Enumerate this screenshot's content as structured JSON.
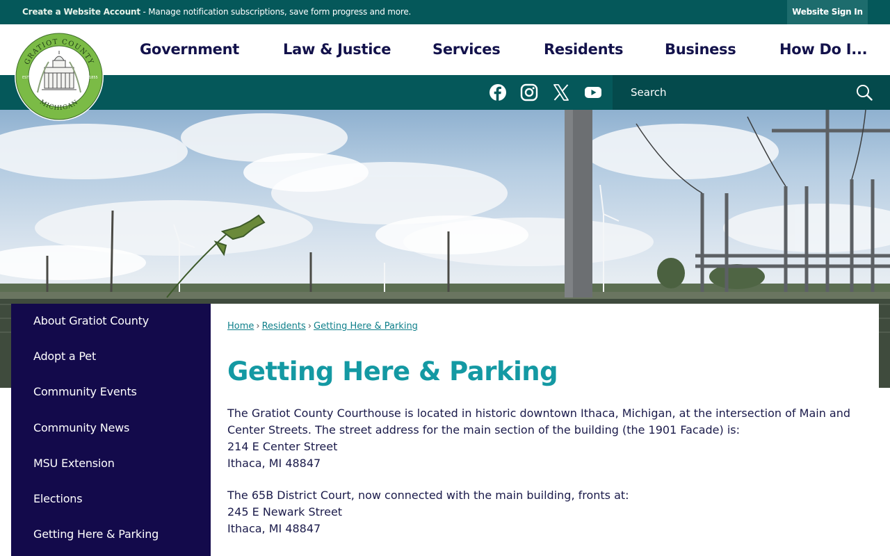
{
  "topbar": {
    "create_account": "Create a Website Account",
    "message": " - Manage notification subscriptions, save form progress and more.",
    "signin_label": "Website Sign In"
  },
  "logo": {
    "text_top": "GRATIOT COUNTY",
    "text_bottom": "MICHIGAN",
    "est": "EST",
    "year": "1855"
  },
  "nav": {
    "items": [
      "Government",
      "Law & Justice",
      "Services",
      "Residents",
      "Business",
      "How Do I..."
    ]
  },
  "social": {
    "icons": [
      "facebook-icon",
      "instagram-icon",
      "x-icon",
      "youtube-icon"
    ]
  },
  "search": {
    "placeholder": "Search"
  },
  "colors": {
    "teal_dark": "#05585a",
    "navy": "#130a4b",
    "title_teal": "#1499a3",
    "link_teal": "#0e7f8a"
  },
  "sidebar": {
    "items": [
      {
        "label": "About Gratiot County"
      },
      {
        "label": "Adopt a Pet"
      },
      {
        "label": "Community Events"
      },
      {
        "label": "Community News"
      },
      {
        "label": "MSU Extension"
      },
      {
        "label": "Elections"
      },
      {
        "label": "Getting Here & Parking"
      }
    ]
  },
  "breadcrumb": {
    "items": [
      "Home",
      "Residents",
      "Getting Here & Parking"
    ],
    "separator": "›"
  },
  "page": {
    "title": "Getting Here & Parking",
    "p1": "The Gratiot County Courthouse is located in historic downtown Ithaca, Michigan, at the intersection of Main and Center Streets. The street address for the main section of the building (the 1901 Facade) is:",
    "addr1_line1": "214 E Center Street",
    "addr1_line2": "Ithaca, MI 48847",
    "p2": "The 65B District Court, now connected with the main building, fronts at:",
    "addr2_line1": "245 E Newark Street",
    "addr2_line2": "Ithaca, MI 48847"
  }
}
